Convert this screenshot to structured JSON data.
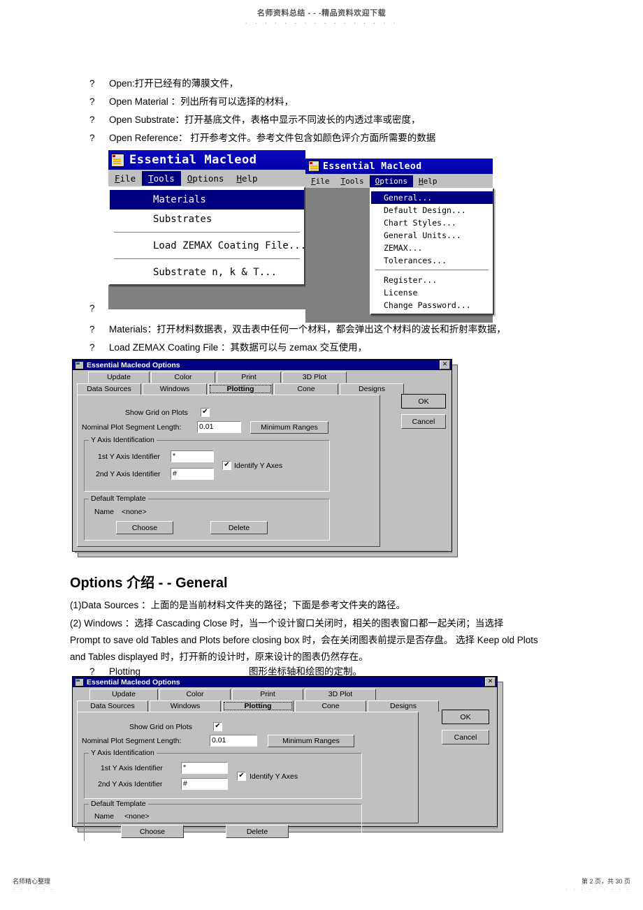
{
  "header": {
    "watermark": "名师资料总结 - - -精品资料欢迎下载",
    "dots": "· · · · · · · · · · · · · · · ·"
  },
  "bullets": [
    {
      "marker": "?",
      "text": "Open:打开已经有的薄膜文件，"
    },
    {
      "marker": "?",
      "text": "Open Material ：列出所有可以选择的材料，"
    },
    {
      "marker": "?",
      "text": "Open Substrate：打开基底文件，表格中显示不同波长的内透过率或密度，"
    },
    {
      "marker": "?",
      "text": "Open Reference： 打开参考文件。参考文件包含如颜色评介方面所需要的数据"
    }
  ],
  "app_tools": {
    "title": "Essential Macleod",
    "icon": "macleod-app-icon",
    "menus": [
      {
        "label": "File",
        "accel": "F",
        "selected": false
      },
      {
        "label": "Tools",
        "accel": "T",
        "selected": true
      },
      {
        "label": "Options",
        "accel": "O",
        "selected": false
      },
      {
        "label": "Help",
        "accel": "H",
        "selected": false
      }
    ],
    "dropdown": [
      {
        "label": "Materials",
        "accel": "M",
        "highlighted": true,
        "sep_after": false
      },
      {
        "label": "Substrates",
        "accel": "S",
        "highlighted": false,
        "sep_after": true
      },
      {
        "label": "Load ZEMAX Coating File...",
        "accel": "Z",
        "highlighted": false,
        "sep_after": true
      },
      {
        "label": "Substrate n, k & T...",
        "accel": "",
        "highlighted": false,
        "sep_after": false
      }
    ]
  },
  "app_options": {
    "title": "Essential Macleod",
    "icon": "macleod-app-icon",
    "menus": [
      {
        "label": "File",
        "accel": "F",
        "selected": false
      },
      {
        "label": "Tools",
        "accel": "T",
        "selected": false
      },
      {
        "label": "Options",
        "accel": "O",
        "selected": true
      },
      {
        "label": "Help",
        "accel": "H",
        "selected": false
      }
    ],
    "dropdown": [
      {
        "label": "General...",
        "accel": "G",
        "highlighted": true,
        "sep_after": false
      },
      {
        "label": "Default Design...",
        "accel": "D",
        "highlighted": false,
        "sep_after": false
      },
      {
        "label": "Chart Styles...",
        "accel": "C",
        "highlighted": false,
        "sep_after": false
      },
      {
        "label": "General Units...",
        "accel": "U",
        "highlighted": false,
        "sep_after": false
      },
      {
        "label": "ZEMAX...",
        "accel": "Z",
        "highlighted": false,
        "sep_after": false
      },
      {
        "label": "Tolerances...",
        "accel": "T",
        "highlighted": false,
        "sep_after": true
      },
      {
        "label": "Register...",
        "accel": "R",
        "highlighted": false,
        "sep_after": false
      },
      {
        "label": "License",
        "accel": "L",
        "highlighted": false,
        "sep_after": false
      },
      {
        "label": "Change Password...",
        "accel": "C",
        "highlighted": false,
        "sep_after": false
      }
    ]
  },
  "mid_bullets": [
    {
      "marker": "?",
      "text": ""
    },
    {
      "marker": "?",
      "text": "Materials：打开材料数据表，双击表中任何一个材料，都会弹出这个材料的波长和折射率数据，"
    },
    {
      "marker": "?",
      "text": "Load ZEMAX Coating File  ：其数据可以与  zemax 交互使用，"
    }
  ],
  "options_dialog": {
    "title": "Essential Macleod Options",
    "close_label": "✕",
    "tabs_row1": [
      {
        "label": "Update",
        "active": false
      },
      {
        "label": "Color",
        "active": false
      },
      {
        "label": "Print",
        "active": false
      },
      {
        "label": "3D Plot",
        "active": false
      }
    ],
    "tabs_row2": [
      {
        "label": "Data Sources",
        "active": false
      },
      {
        "label": "Windows",
        "active": false
      },
      {
        "label": "Plotting",
        "active": true
      },
      {
        "label": "Cone",
        "active": false
      },
      {
        "label": "Designs",
        "active": false
      }
    ],
    "show_grid_label": "Show Grid on Plots",
    "show_grid_checked": "✔",
    "nominal_label": "Nominal Plot Segment Length:",
    "nominal_value": "0.01",
    "minimum_ranges_button": "Minimum Ranges",
    "y_axis_group": "Y Axis Identification",
    "y1_label": "1st Y Axis Identifier",
    "y1_value": "*",
    "y2_label": "2nd Y Axis Identifier",
    "y2_value": "#",
    "identify_y_label": "Identify Y Axes",
    "identify_y_checked": "✔",
    "default_template_group": "Default Template",
    "name_label": "Name",
    "name_value": "<none>",
    "choose_button": "Choose",
    "delete_button": "Delete",
    "ok_button": "OK",
    "cancel_button": "Cancel"
  },
  "section": {
    "heading": "Options 介绍 - -   General",
    "p1": "(1)Data Sources ：上面的是当前材料文件夹的路径；下面是参考文件夹的路径。",
    "p2_l1": "(2) Windows ：选择 Cascading Close 时，当一个设计窗口关闭时，相关的图表窗口都一起关闭；当选择",
    "p2_l2": "Prompt to save old Tables and Plots before closing box  时，会在关闭图表前提示是否存盘。   选择 Keep old Plots",
    "p2_l3": "and Tables displayed 时，打开新的设计时，原来设计的图表仍然存在。",
    "p3_marker": "?",
    "p3_a": "Plotting",
    "p3_b": "图形坐标轴和绘图的定制。"
  },
  "footer": {
    "left": "名师精心整理",
    "left_dots": "· · · · · ·",
    "right": "第 2 页，共 30 页",
    "right_dots": "· · · · · · · · ·"
  },
  "colors": {
    "titlebar": "#000080",
    "menu_highlight": "#000080",
    "face": "#c0c0c0",
    "app_title": "#0000bf"
  }
}
